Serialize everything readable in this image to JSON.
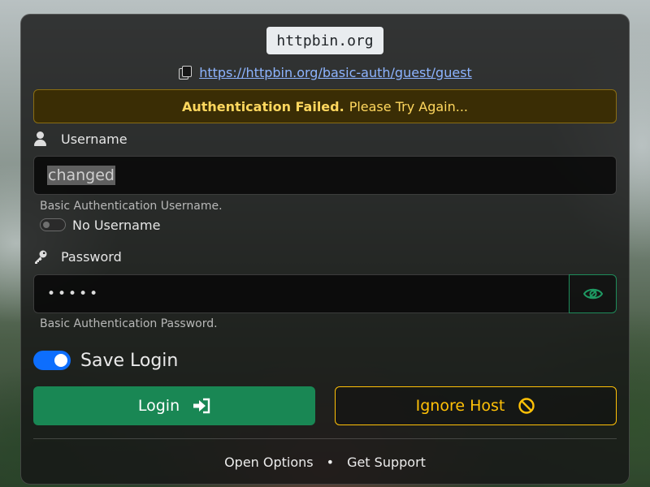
{
  "header": {
    "host": "httpbin.org",
    "url": "https://httpbin.org/basic-auth/guest/guest"
  },
  "alert": {
    "strong": "Authentication Failed.",
    "message": "Please Try Again..."
  },
  "username": {
    "label": "Username",
    "value": "changed",
    "help": "Basic Authentication Username.",
    "no_username_label": "No Username",
    "no_username_enabled": false
  },
  "password": {
    "label": "Password",
    "masked_value": "•••••",
    "help": "Basic Authentication Password."
  },
  "save_login": {
    "label": "Save Login",
    "enabled": true
  },
  "buttons": {
    "login": "Login",
    "ignore": "Ignore Host"
  },
  "footer": {
    "options": "Open Options",
    "separator": "•",
    "support": "Get Support"
  },
  "colors": {
    "accent_blue": "#0d6efd",
    "success": "#198754",
    "warning": "#ffc107",
    "link": "#8db4ff"
  },
  "icons": {
    "copy": "copy-icon",
    "user": "user-icon",
    "key": "key-icon",
    "eye": "eye-icon",
    "login": "login-icon",
    "ban": "ban-icon"
  }
}
